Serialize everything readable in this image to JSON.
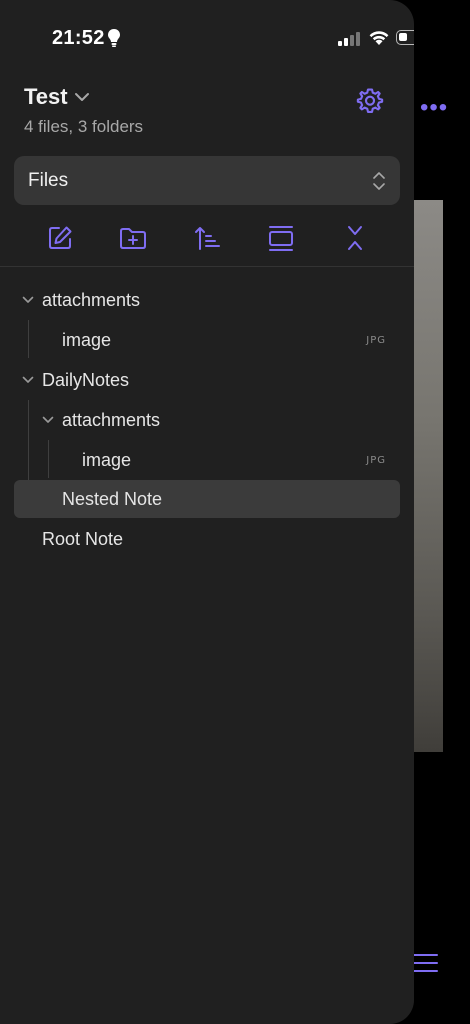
{
  "status": {
    "time": "21:52"
  },
  "vault": {
    "name": "Test",
    "summary": "4 files, 3 folders"
  },
  "view_select": {
    "label": "Files"
  },
  "toolbar": {
    "items": [
      {
        "icon": "new-note-icon"
      },
      {
        "icon": "new-folder-icon"
      },
      {
        "icon": "sort-icon"
      },
      {
        "icon": "auto-reveal-icon"
      },
      {
        "icon": "collapse-all-icon"
      }
    ]
  },
  "tree": {
    "items": [
      {
        "label": "attachments",
        "type": "folder",
        "expanded": true
      },
      {
        "label": "image",
        "type": "file",
        "ext": "JPG"
      },
      {
        "label": "DailyNotes",
        "type": "folder",
        "expanded": true
      },
      {
        "label": "attachments",
        "type": "folder",
        "expanded": true
      },
      {
        "label": "image",
        "type": "file",
        "ext": "JPG"
      },
      {
        "label": "Nested Note",
        "type": "file",
        "selected": true
      },
      {
        "label": "Root Note",
        "type": "file"
      }
    ]
  },
  "colors": {
    "accent": "#7f6df2",
    "drawer_bg": "#202020",
    "selected_row": "#3b3b3b"
  }
}
